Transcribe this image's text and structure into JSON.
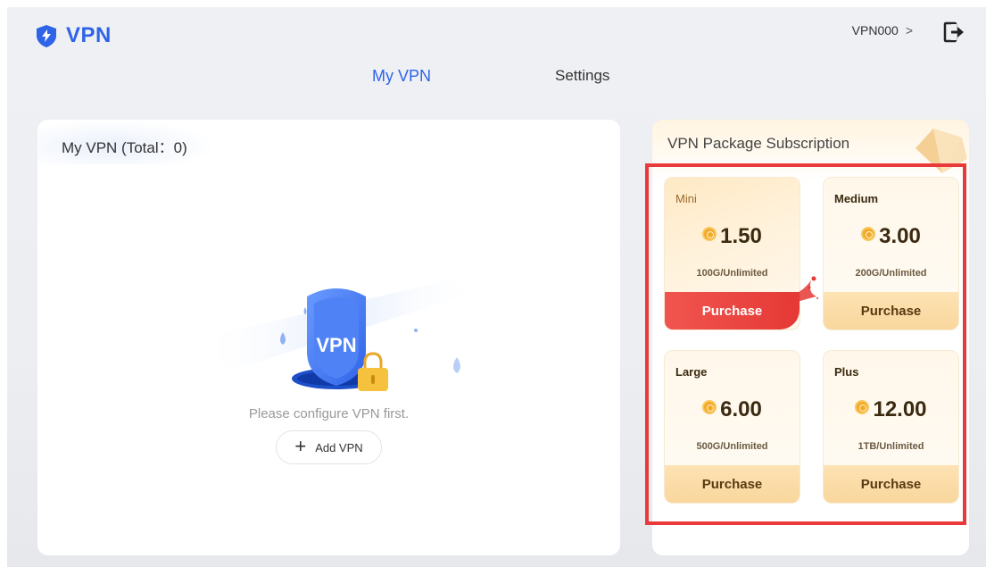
{
  "header": {
    "logo_text": "VPN",
    "username": "VPN000",
    "chevron": ">"
  },
  "tabs": [
    {
      "label": "My VPN",
      "active": true
    },
    {
      "label": "Settings",
      "active": false
    }
  ],
  "my_vpn": {
    "title": "My VPN (Total：0)",
    "illustration_label": "VPN",
    "empty_message": "Please configure VPN first.",
    "add_button_label": "Add VPN"
  },
  "subscription": {
    "title": "VPN Package Subscription",
    "packages": [
      {
        "name": "Mini",
        "price": "1.50",
        "data": "100G/Unlimited",
        "button": "Purchase",
        "selected": true
      },
      {
        "name": "Medium",
        "price": "3.00",
        "data": "200G/Unlimited",
        "button": "Purchase",
        "selected": false
      },
      {
        "name": "Large",
        "price": "6.00",
        "data": "500G/Unlimited",
        "button": "Purchase",
        "selected": false
      },
      {
        "name": "Plus",
        "price": "12.00",
        "data": "1TB/Unlimited",
        "button": "Purchase",
        "selected": false
      }
    ]
  },
  "colors": {
    "accent": "#2f63e8",
    "highlight_border": "#e83a3a",
    "purchase_selected": "#e53935",
    "purchase_default": "#fde2b3"
  }
}
